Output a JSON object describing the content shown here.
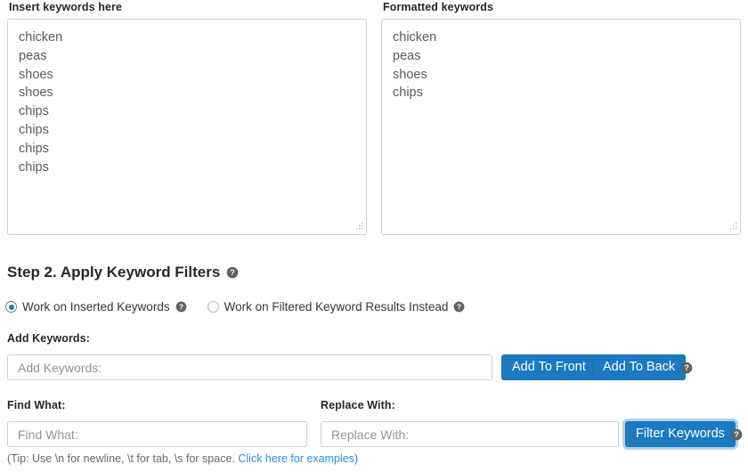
{
  "step1": {
    "insert_label": "Insert keywords here",
    "formatted_label": "Formatted keywords",
    "insert_keywords_value": "chicken\npeas\nshoes\nshoes\nchips\nchips\nchips\nchips",
    "formatted_keywords_value": "chicken\npeas\nshoes\nchips",
    "insert_keywords_lines": [
      "chicken",
      "peas",
      "shoes",
      "shoes",
      "chips",
      "chips",
      "chips",
      "chips"
    ],
    "formatted_keywords_lines": [
      "chicken",
      "peas",
      "shoes",
      "chips"
    ]
  },
  "step2": {
    "heading": "Step 2. Apply Keyword Filters",
    "help_icon": "question-mark-circle-icon",
    "radios": [
      {
        "label": "Work on Inserted Keywords",
        "checked": true,
        "help_icon": "question-mark-circle-icon"
      },
      {
        "label": "Work on Filtered Keyword Results Instead",
        "checked": false,
        "help_icon": "question-mark-circle-icon"
      }
    ],
    "add_keywords": {
      "label": "Add Keywords:",
      "placeholder": "Add Keywords:",
      "value": "",
      "add_to_front_label": "Add To Front",
      "add_to_back_label": "Add To Back",
      "help_icon": "question-mark-circle-icon"
    },
    "find_what": {
      "label": "Find What:",
      "placeholder": "Find What:",
      "value": ""
    },
    "replace_with": {
      "label": "Replace With:",
      "placeholder": "Replace With:",
      "value": ""
    },
    "filter_keywords_label": "Filter Keywords",
    "filter_help_icon": "question-mark-circle-icon",
    "tip": {
      "prefix": "(Tip: Use \\n for newline, \\t for tab, \\s for space. ",
      "link_text": "Click here for examples",
      "suffix": ")"
    }
  },
  "colors": {
    "primary_blue": "#1b7ac0",
    "link_blue": "#2d8fe0",
    "border_gray": "#ccd0d4",
    "text_dark": "#23282d",
    "text_muted": "#555d66",
    "placeholder_gray": "#8d949b",
    "help_icon_gray": "#5b6165"
  }
}
